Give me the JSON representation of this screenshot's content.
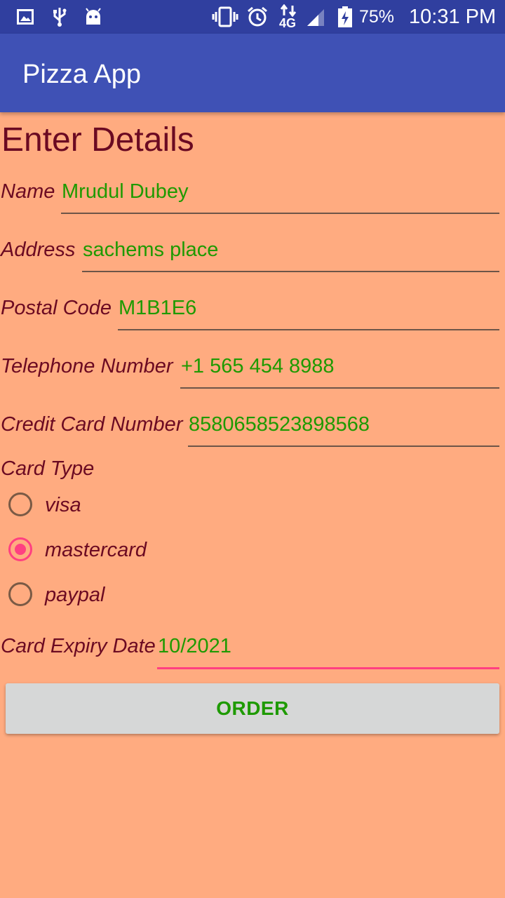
{
  "status_bar": {
    "battery_percent": "75%",
    "network": "4G",
    "time": "10:31 PM",
    "icons_left": [
      "image-icon",
      "usb-icon",
      "android-icon"
    ],
    "icons_right": [
      "vibrate-icon",
      "alarm-icon",
      "data-4g-icon",
      "signal-icon",
      "battery-charging-icon"
    ]
  },
  "app_bar": {
    "title": "Pizza App"
  },
  "form": {
    "heading": "Enter Details",
    "fields": [
      {
        "label": "Name",
        "value": "Mrudul Dubey"
      },
      {
        "label": "Address",
        "value": "sachems place"
      },
      {
        "label": "Postal Code",
        "value": "M1B1E6"
      },
      {
        "label": "Telephone Number",
        "value": "+1 565 454 8988"
      },
      {
        "label": "Credit Card Number",
        "value": "8580658523898568"
      }
    ],
    "card_type": {
      "label": "Card Type",
      "options": [
        "visa",
        "mastercard",
        "paypal"
      ],
      "selected": "mastercard"
    },
    "expiry": {
      "label": "Card Expiry Date",
      "value": "10/2021"
    },
    "order_label": "ORDER"
  },
  "colors": {
    "background": "#FFAB80",
    "app_bar": "#3F51B5",
    "status_bar": "#303F9F",
    "label_text": "#6B0A22",
    "value_text": "#1E9A00",
    "accent": "#FF4081",
    "button": "#D6D7D7"
  }
}
